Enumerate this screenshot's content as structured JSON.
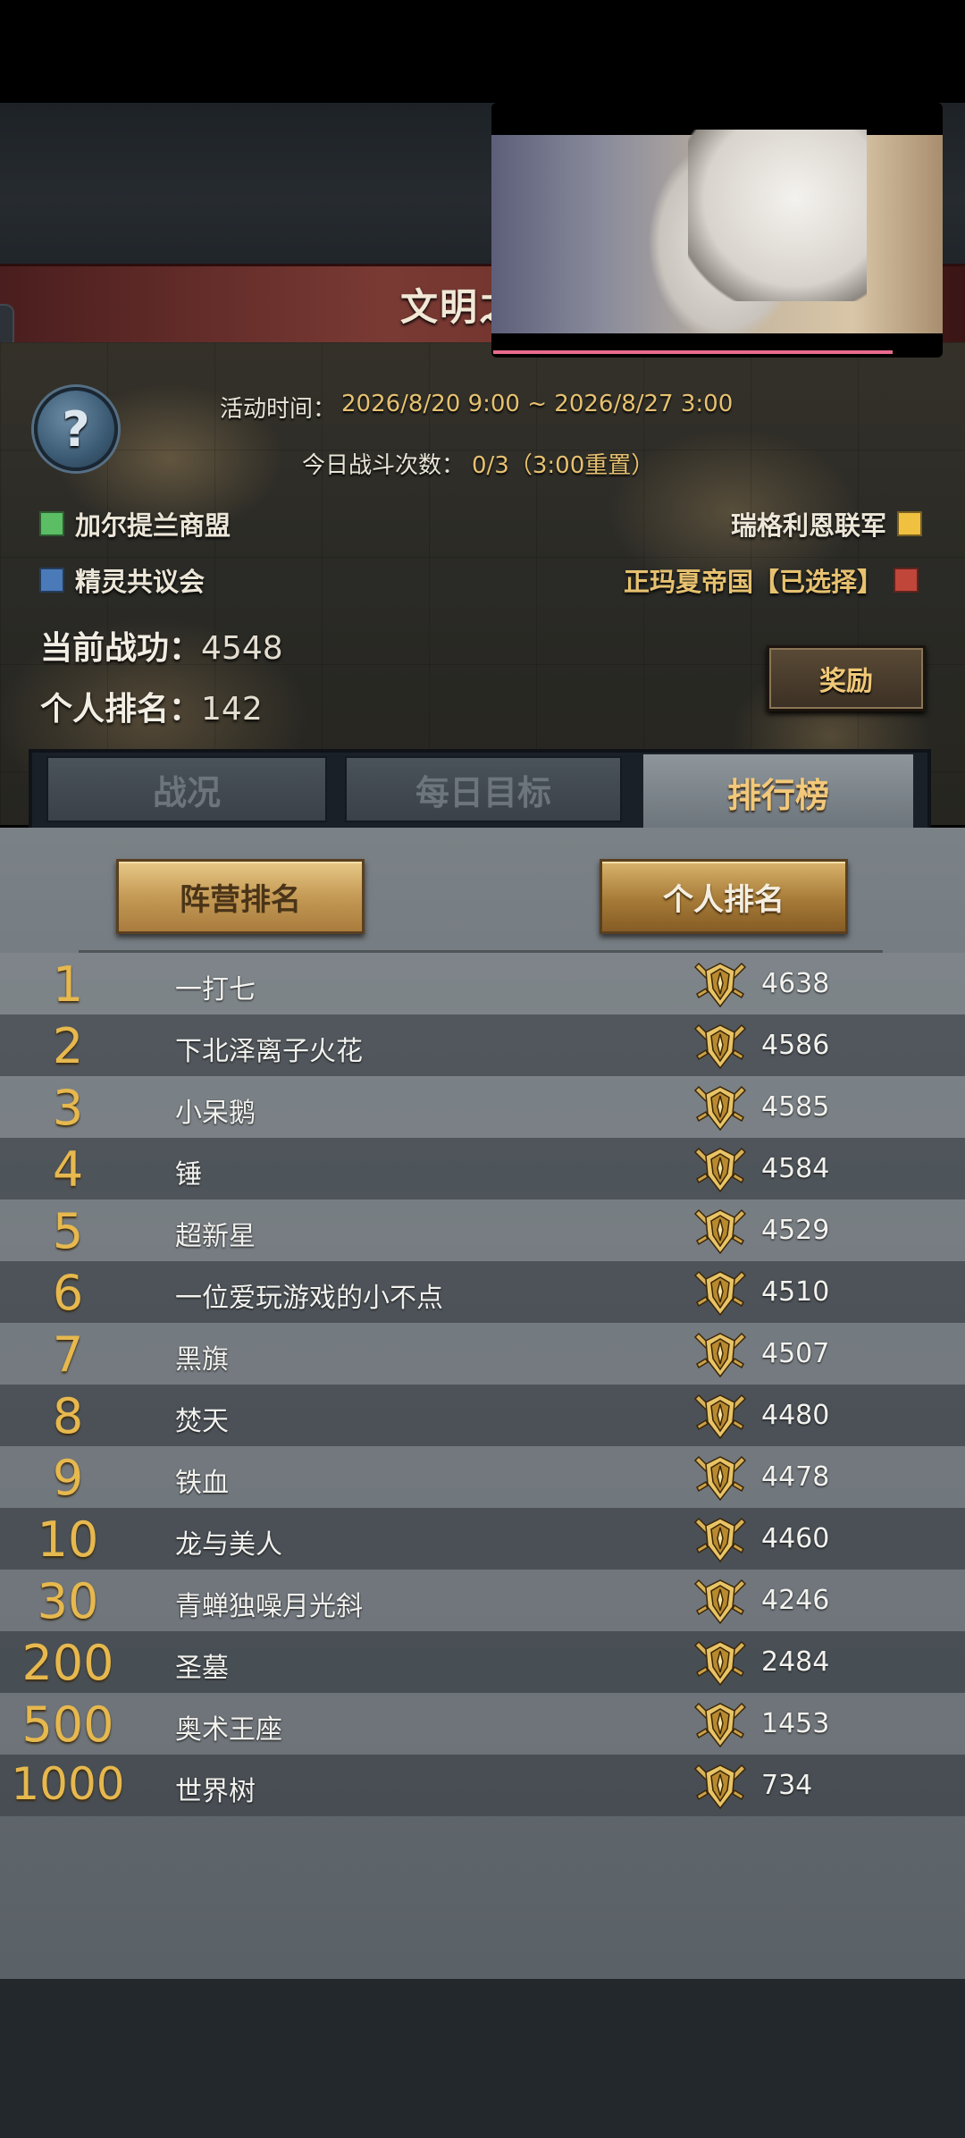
{
  "header": {
    "title": "文明之"
  },
  "event": {
    "time_label": "活动时间：",
    "time_value": "2026/8/20 9:00 ~ 2026/8/27 3:00",
    "battles_label": "今日战斗次数：",
    "battles_value": "0/3（3:00重置）"
  },
  "factions": [
    {
      "name": "加尔提兰商盟",
      "color": "#5bbd64"
    },
    {
      "name": "精灵共议会",
      "color": "#4a7ab8"
    },
    {
      "name": "瑞格利恩联军",
      "color": "#f0c040"
    },
    {
      "name": "正玛夏帝国【已选择】",
      "color": "#c0463a"
    }
  ],
  "stats": {
    "merit_label": "当前战功：",
    "merit_value": "4548",
    "rank_label": "个人排名：",
    "rank_value": "142"
  },
  "reward_button": "奖励",
  "tabs": [
    {
      "label": "战况"
    },
    {
      "label": "每日目标"
    },
    {
      "label": "排行榜"
    }
  ],
  "sub_tabs": {
    "faction": "阵营排名",
    "personal": "个人排名"
  },
  "ranking": [
    {
      "rank": "1",
      "name": "一打七",
      "score": "4638"
    },
    {
      "rank": "2",
      "name": "下北泽离子火花",
      "score": "4586"
    },
    {
      "rank": "3",
      "name": "小呆鹅",
      "score": "4585"
    },
    {
      "rank": "4",
      "name": "锤",
      "score": "4584"
    },
    {
      "rank": "5",
      "name": "超新星",
      "score": "4529"
    },
    {
      "rank": "6",
      "name": "一位爱玩游戏的小不点",
      "score": "4510"
    },
    {
      "rank": "7",
      "name": "黑旗",
      "score": "4507"
    },
    {
      "rank": "8",
      "name": "焚天",
      "score": "4480"
    },
    {
      "rank": "9",
      "name": "铁血",
      "score": "4478"
    },
    {
      "rank": "10",
      "name": "龙与美人",
      "score": "4460"
    },
    {
      "rank": "30",
      "name": "青蝉独噪月光斜",
      "score": "4246"
    },
    {
      "rank": "200",
      "name": "圣墓",
      "score": "2484"
    },
    {
      "rank": "500",
      "name": "奥术王座",
      "score": "1453"
    },
    {
      "rank": "1000",
      "name": "世界树",
      "score": "734"
    }
  ],
  "icons": {
    "help": "question-mark-icon",
    "medal": "gold-shield-swords-icon"
  }
}
